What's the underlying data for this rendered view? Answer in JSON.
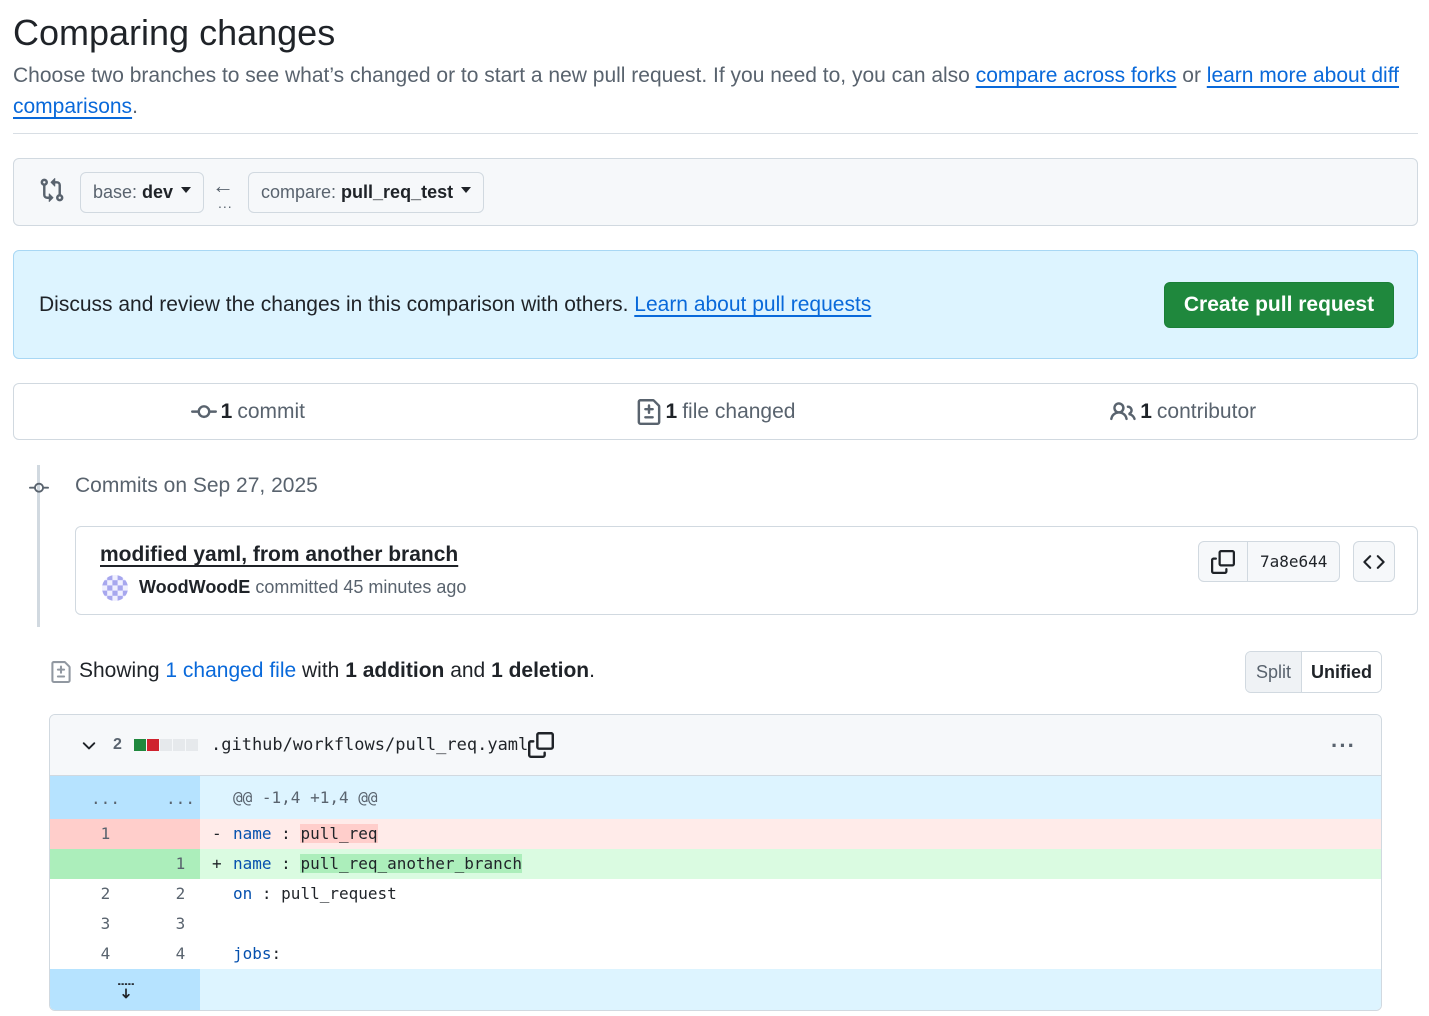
{
  "header": {
    "title": "Comparing changes",
    "subtitle_text": "Choose two branches to see what’s changed or to start a new pull request. If you need to, you can also ",
    "link_forks": "compare across forks",
    "or_text": " or ",
    "link_learn": "learn more about diff comparisons",
    "period": "."
  },
  "range": {
    "base_prefix": "base:",
    "base_value": "dev",
    "arrow": "←",
    "dots": "...",
    "compare_prefix": "compare:",
    "compare_value": "pull_req_test"
  },
  "flash": {
    "text": "Discuss and review the changes in this comparison with others. ",
    "link": "Learn about pull requests",
    "button": "Create pull request"
  },
  "summary": {
    "commits_count": "1",
    "commits_label": "commit",
    "files_count": "1",
    "files_label": "file changed",
    "contributors_count": "1",
    "contributors_label": "contributor"
  },
  "commits": {
    "date_header": "Commits on Sep 27, 2025",
    "items": [
      {
        "title": "modified yaml, from another branch",
        "author": "WoodWoodE",
        "action": " committed 45 minutes ago",
        "sha": "7a8e644"
      }
    ]
  },
  "toc": {
    "showing": "Showing ",
    "changed_link": "1 changed file",
    "with": " with ",
    "additions": "1 addition",
    "and": " and ",
    "deletions": "1 deletion",
    "period": ".",
    "split_label": "Split",
    "unified_label": "Unified"
  },
  "file": {
    "diffstat_count": "2",
    "diffstat_blocks": [
      "added",
      "deleted",
      "neutral",
      "neutral",
      "neutral"
    ],
    "path": ".github/workflows/pull_req.yaml",
    "kebab": "···",
    "hunk_dots_left": "...",
    "hunk_dots_right": "...",
    "hunk_header": "@@ -1,4 +1,4 @@",
    "lines": [
      {
        "type": "del",
        "old": "1",
        "new": "",
        "sign": "-",
        "key": "name",
        "sep": " : ",
        "value": "pull_req"
      },
      {
        "type": "add",
        "old": "",
        "new": "1",
        "sign": "+",
        "key": "name",
        "sep": " : ",
        "value": "pull_req_another_branch"
      },
      {
        "type": "ctx",
        "old": "2",
        "new": "2",
        "sign": "",
        "key": "on",
        "sep": " : ",
        "value": "pull_request"
      },
      {
        "type": "ctx",
        "old": "3",
        "new": "3",
        "sign": "",
        "key": "",
        "sep": "",
        "value": ""
      },
      {
        "type": "ctx",
        "old": "4",
        "new": "4",
        "sign": "",
        "key": "jobs",
        "sep": ":",
        "value": ""
      }
    ]
  },
  "colors": {
    "accent": "#0969da",
    "success_button": "#1f883d",
    "diff_added": "#dafbe1",
    "diff_deleted": "#ffebe9",
    "hunk": "#ddf4ff"
  }
}
